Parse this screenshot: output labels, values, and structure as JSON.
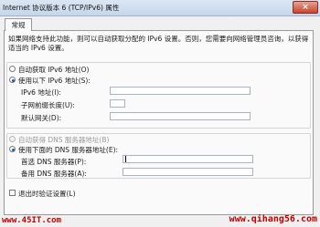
{
  "window": {
    "title": "Internet 协议版本 6 (TCP/IPv6) 属性",
    "close_label": "×"
  },
  "tab": {
    "label": "常规"
  },
  "description": "如果网络支持此功能，则可以自动获取分配的 IPv6 设置。否则，您需要向网络管理员咨询，以获得适当的 IPv6 设置。",
  "ip": {
    "auto_label": "自动获取 IPv6 地址(O)",
    "manual_label": "使用以下 IPv6 地址(S):",
    "address_label": "IPv6 地址(I):",
    "prefix_label": "子网前缀长度(U):",
    "gateway_label": "默认网关(D):",
    "address_value": "",
    "prefix_value": "",
    "gateway_value": ""
  },
  "dns": {
    "auto_label": "自动获得 DNS 服务器地址(B)",
    "manual_label": "使用下面的 DNS 服务器地址(E):",
    "preferred_label": "首选 DNS 服务器(P):",
    "alternate_label": "备用 DNS 服务器(A):",
    "preferred_value": "",
    "alternate_value": ""
  },
  "validate_label": "退出时验证设置(L)",
  "watermarks": {
    "left": "www.45IT.com",
    "right": "www.qihang56.com"
  }
}
